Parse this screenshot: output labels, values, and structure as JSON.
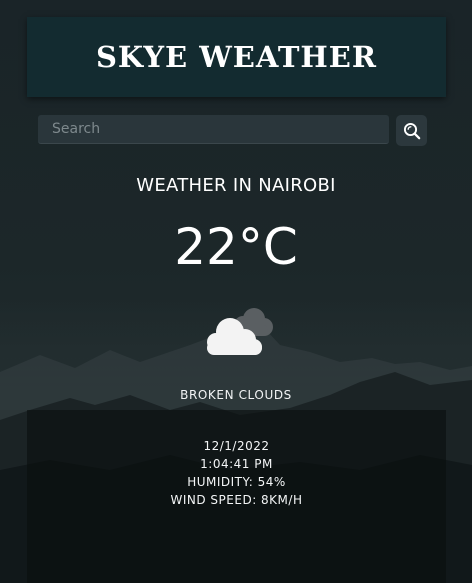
{
  "app": {
    "title": "SKYE WEATHER"
  },
  "search": {
    "placeholder": "Search",
    "value": "",
    "button_icon": "search-icon"
  },
  "weather": {
    "heading": "WEATHER IN NAIROBI",
    "temperature": "22°C",
    "icon": "broken-clouds-icon",
    "description": "BROKEN CLOUDS"
  },
  "details": {
    "date": "12/1/2022",
    "time": "1:04:41 PM",
    "humidity": "HUMIDITY: 54%",
    "wind_speed": "WIND SPEED: 8KM/H"
  },
  "colors": {
    "banner_bg": "#132b30",
    "page_bg": "#1c2729",
    "input_bg": "#2a363b",
    "text": "#ffffff"
  }
}
